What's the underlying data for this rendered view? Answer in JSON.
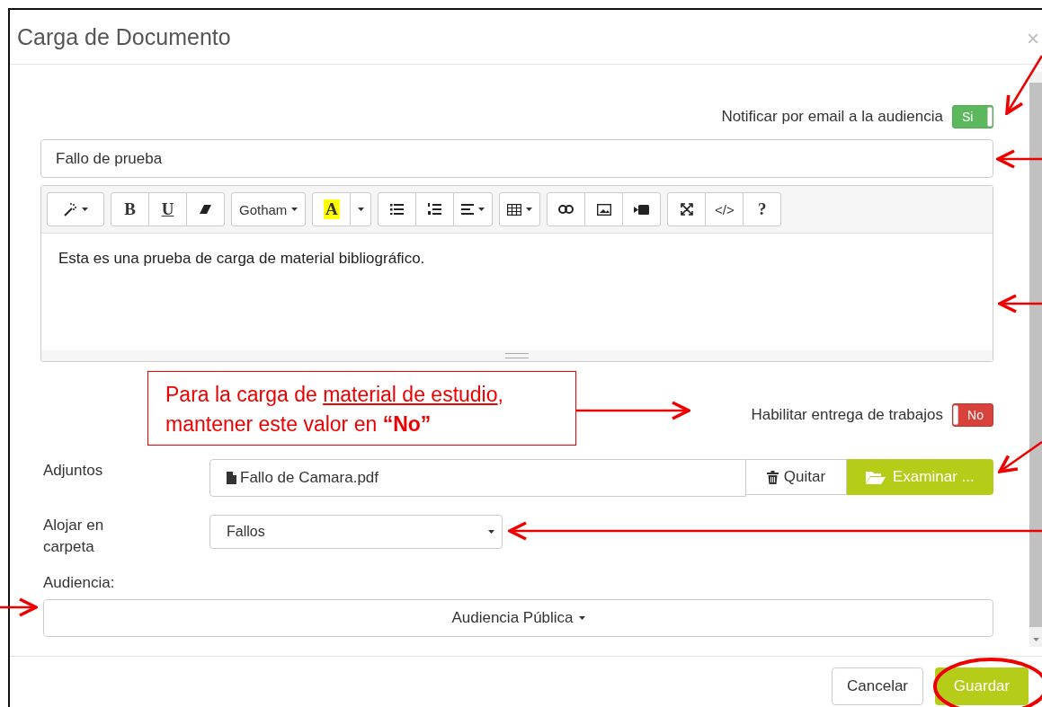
{
  "dialog": {
    "title": "Carga de Documento",
    "close": "×"
  },
  "notify": {
    "label": "Notificar por email a la audiencia",
    "toggle": {
      "text": "Si",
      "on": true
    }
  },
  "title_field": {
    "value": "Fallo de prueba"
  },
  "editor": {
    "toolbar": [
      [
        {
          "kind": "wand",
          "caret": true
        }
      ],
      [
        {
          "kind": "bold",
          "label": "B"
        },
        {
          "kind": "underline",
          "label": "U"
        },
        {
          "kind": "eraser"
        }
      ],
      [
        {
          "kind": "text",
          "label": "Gotham",
          "caret": true
        }
      ],
      [
        {
          "kind": "highlight",
          "label": "A"
        },
        {
          "kind": "caret"
        }
      ],
      [
        {
          "kind": "list-bullets"
        },
        {
          "kind": "list-numbers"
        },
        {
          "kind": "align",
          "caret": true
        }
      ],
      [
        {
          "kind": "table",
          "caret": true
        }
      ],
      [
        {
          "kind": "link"
        },
        {
          "kind": "picture"
        },
        {
          "kind": "video"
        }
      ],
      [
        {
          "kind": "fullscreen"
        },
        {
          "kind": "text",
          "label": "</>"
        },
        {
          "kind": "bold",
          "label": "?"
        }
      ]
    ],
    "content": "Esta es una prueba de carga de material bibliográfico."
  },
  "assignments": {
    "label": "Habilitar entrega de trabajos",
    "toggle": {
      "text": "No",
      "on": false
    }
  },
  "callout": {
    "before": "Para la carga de ",
    "underlined": "material de estudio",
    "after": ",\nmantener este valor en **“No”**"
  },
  "attachments": {
    "label": "Adjuntos",
    "file": "Fallo de Camara.pdf",
    "remove": "Quitar",
    "browse": "Examinar ..."
  },
  "folder": {
    "label": "Alojar en carpeta",
    "value": "Fallos"
  },
  "audience": {
    "label": "Audiencia:",
    "value": "Audiencia Pública"
  },
  "footer": {
    "buttons": [
      {
        "label": "Cancelar",
        "kind": "default"
      },
      {
        "label": "Guardar",
        "kind": "primary"
      }
    ]
  }
}
